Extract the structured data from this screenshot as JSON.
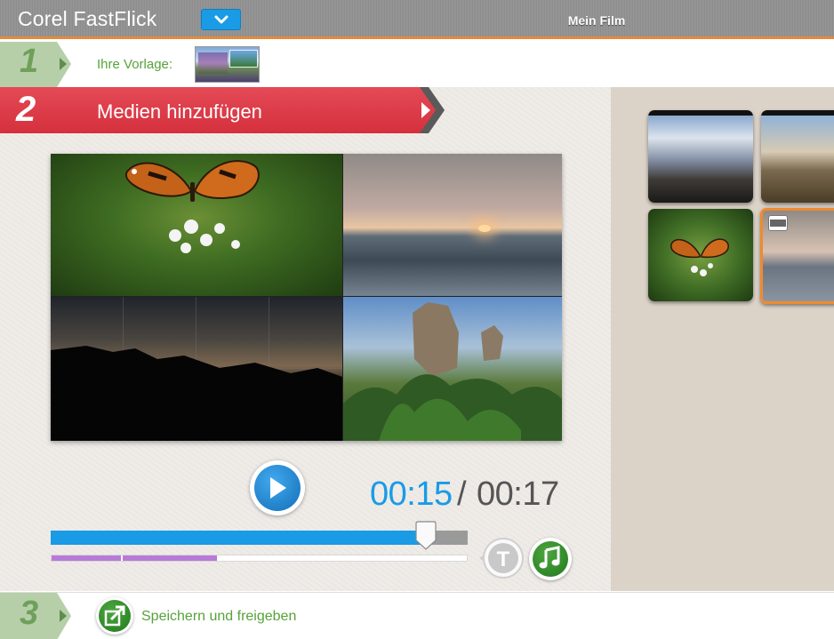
{
  "window": {
    "app_title": "Corel FastFlick",
    "project_title": "Mein Film",
    "accent_color": "#1a9be6"
  },
  "step1": {
    "number": "1",
    "label": "Ihre Vorlage:"
  },
  "step2": {
    "number": "2",
    "label": "Medien hinzufügen",
    "color": "#d5303d"
  },
  "player": {
    "time_current": "00:15",
    "time_separator": "/",
    "time_total": "00:17",
    "progress_fraction": 0.9,
    "text_button_glyph": "T"
  },
  "step3": {
    "number": "3",
    "label": "Speichern und freigeben"
  },
  "icons": [
    "chevron-down-icon",
    "play-icon",
    "text-icon",
    "music-icon",
    "share-icon",
    "film-icon"
  ]
}
